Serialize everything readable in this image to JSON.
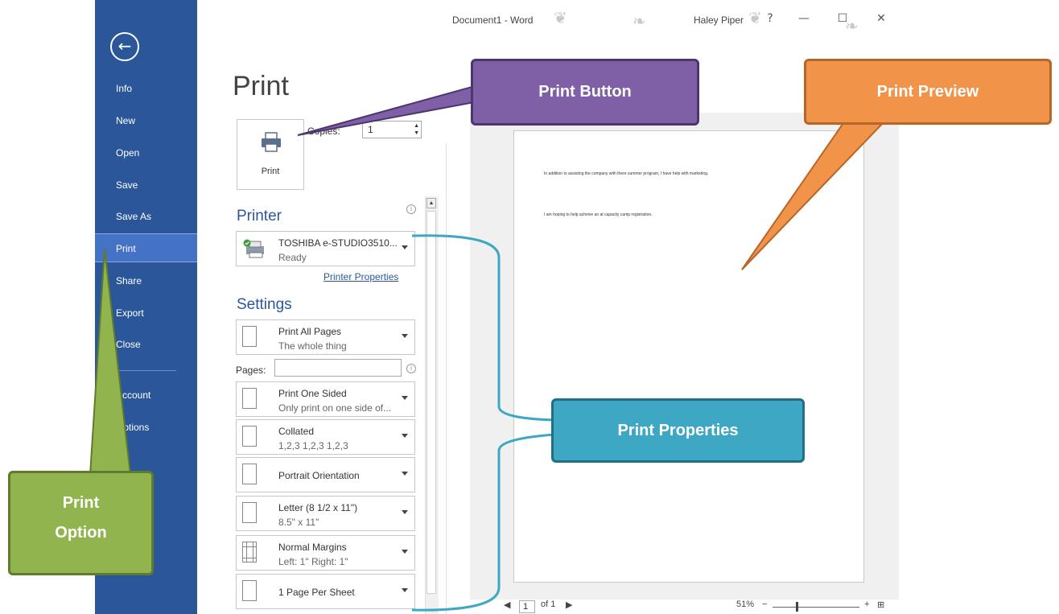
{
  "window": {
    "title": "Document1  -  Word",
    "user": "Haley Piper",
    "help": "?",
    "minimize": "—",
    "maximize": "☐",
    "close": "✕"
  },
  "nav": {
    "back_icon": "arrow-left-circle-icon",
    "items": [
      {
        "label": "Info"
      },
      {
        "label": "New"
      },
      {
        "label": "Open"
      },
      {
        "label": "Save"
      },
      {
        "label": "Save As"
      },
      {
        "label": "Print",
        "active": true
      },
      {
        "label": "Share"
      },
      {
        "label": "Export"
      },
      {
        "label": "Close"
      },
      {
        "label": "Account"
      },
      {
        "label": "Options"
      }
    ]
  },
  "print": {
    "heading": "Print",
    "button_label": "Print",
    "copies_label": "Copies:",
    "copies_value": "1",
    "printer_heading": "Printer",
    "printer_name": "TOSHIBA e-STUDIO3510...",
    "printer_status": "Ready",
    "printer_properties": "Printer Properties",
    "settings_heading": "Settings",
    "pages_label": "Pages:",
    "pages_value": "",
    "settings": [
      {
        "title": "Print All Pages",
        "sub": "The whole thing"
      },
      {
        "title": "Print One Sided",
        "sub": "Only print on one side of..."
      },
      {
        "title": "Collated",
        "sub": "1,2,3   1,2,3   1,2,3"
      },
      {
        "title": "Portrait Orientation",
        "sub": ""
      },
      {
        "title": "Letter (8 1/2 x 11\")",
        "sub": "8.5\" x 11\""
      },
      {
        "title": "Normal Margins",
        "sub": "Left: 1\"   Right: 1\""
      },
      {
        "title": "1 Page Per Sheet",
        "sub": ""
      }
    ]
  },
  "preview": {
    "lines": [
      "In addition to assisting the company with there summer program, I have help with marketing.",
      "I am hoping to help acheive an at capacity camp registration."
    ],
    "page_current": "1",
    "page_of": "of 1",
    "zoom": "51%",
    "zoom_level": 0.27
  },
  "callouts": {
    "print_button": "Print Button",
    "print_preview": "Print Preview",
    "print_properties": "Print Properties",
    "print_option_line1": "Print",
    "print_option_line2": "Option"
  },
  "colors": {
    "nav_bg": "#2b579a",
    "nav_active": "#4472c4",
    "purple": "#7f5fa5",
    "orange": "#f2934a",
    "teal": "#3ea7c4",
    "green": "#92b44f"
  }
}
